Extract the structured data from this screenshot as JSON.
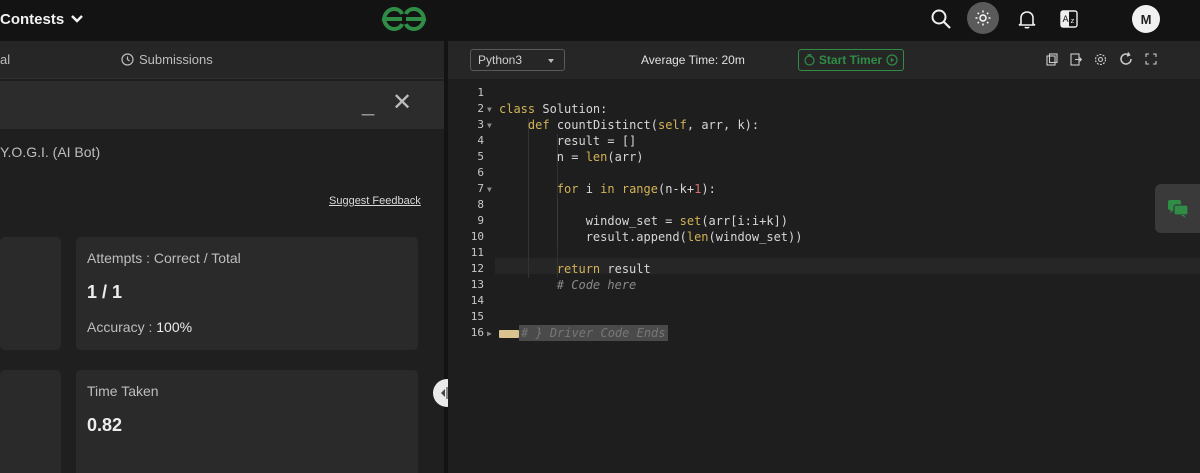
{
  "header": {
    "contests_label": "Contests",
    "avatar_initial": "M"
  },
  "left_panel": {
    "tab_partial_label": "al",
    "submissions_label": "Submissions",
    "chat_minimize": "_",
    "chat_close": "✕",
    "yogi_label": "Y.O.G.I. (AI Bot)",
    "suggest_feedback": "Suggest Feedback",
    "stats": {
      "attempts_label": "Attempts : Correct / Total",
      "attempts_value": "1 / 1",
      "accuracy_label": "Accuracy :",
      "accuracy_value": "100%",
      "time_label": "Time Taken",
      "time_value": "0.82"
    }
  },
  "editor": {
    "language": "Python3",
    "average_time": "Average Time: 20m",
    "start_timer": "Start Timer",
    "line_numbers": [
      "1",
      "2",
      "3",
      "4",
      "5",
      "6",
      "7",
      "8",
      "9",
      "10",
      "11",
      "12",
      "13",
      "14",
      "15",
      "16"
    ],
    "code": {
      "l2_kw": "class",
      "l2_rest": " Solution:",
      "l3_kw": "def",
      "l3_name": " countDistinct(",
      "l3_self": "self",
      "l3_rest": ", arr, k):",
      "l4": "result = []",
      "l5_pre": "n = ",
      "l5_fn": "len",
      "l5_post": "(arr)",
      "l7_for": "for",
      "l7_mid": " i ",
      "l7_in": "in",
      "l7_range": " range",
      "l7_args_pre": "(n-k+",
      "l7_one": "1",
      "l7_args_post": "):",
      "l9_pre": "window_set = ",
      "l9_set": "set",
      "l9_post": "(arr[i:i+k])",
      "l10_pre": "result.append(",
      "l10_len": "len",
      "l10_post": "(window_set))",
      "l12_kw": "return",
      "l12_rest": " result",
      "l13": "# Code here",
      "l16": "# } Driver Code Ends"
    }
  },
  "colors": {
    "brand_green": "#2f8d46",
    "keyword": "#d2b356",
    "comment": "#8a8a8a"
  },
  "icons": [
    "chevron-down-icon",
    "gfg-logo",
    "search-icon",
    "sun-icon",
    "bell-icon",
    "translate-icon",
    "clock-icon",
    "copy-icon",
    "export-icon",
    "settings-icon",
    "reset-icon",
    "fullscreen-icon",
    "chat-icon",
    "resize-handle-icon"
  ]
}
